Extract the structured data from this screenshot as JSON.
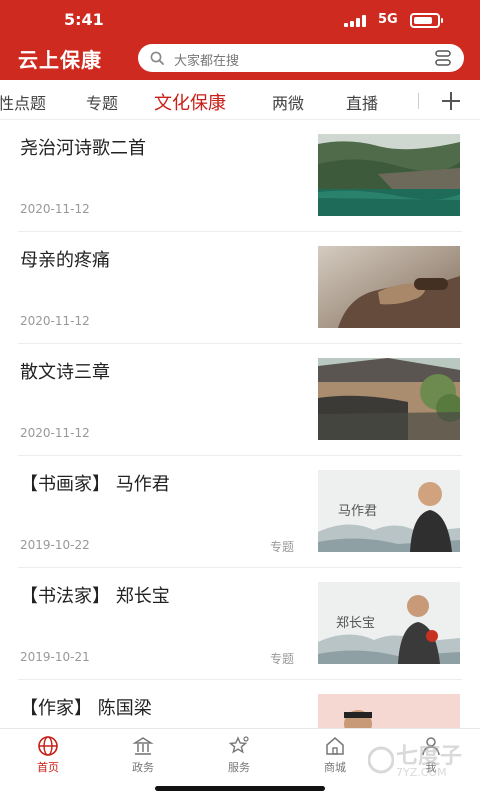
{
  "status_bar": {
    "time": "5:41",
    "network": "5G"
  },
  "header": {
    "app_title": "云上保康",
    "search_placeholder": "大家都在搜"
  },
  "tabs": [
    "性点题",
    "专题",
    "文化保康",
    "两微",
    "直播"
  ],
  "active_tab": "文化保康",
  "articles": [
    {
      "title": "尧治河诗歌二首",
      "date": "2020-11-12",
      "tag": ""
    },
    {
      "title": "母亲的疼痛",
      "date": "2020-11-12",
      "tag": ""
    },
    {
      "title": "散文诗三章",
      "date": "2020-11-12",
      "tag": ""
    },
    {
      "title": "【书画家】 马作君",
      "date": "2019-10-22",
      "tag": "专题",
      "image_caption": "马作君"
    },
    {
      "title": "【书法家】 郑长宝",
      "date": "2019-10-21",
      "tag": "专题",
      "image_caption": "郑长宝"
    },
    {
      "title": "【作家】 陈国梁",
      "date": "",
      "tag": ""
    }
  ],
  "bottom_tabs": [
    {
      "label": "首页",
      "icon": "globe-icon"
    },
    {
      "label": "政务",
      "icon": "building-icon"
    },
    {
      "label": "服务",
      "icon": "star-service-icon"
    },
    {
      "label": "商城",
      "icon": "house-icon"
    },
    {
      "label": "我",
      "icon": "user-icon"
    }
  ],
  "watermark": {
    "text": "七度子",
    "url": "7YZ.COM"
  },
  "colors": {
    "brand_red": "#cf2a1f",
    "active_red": "#c81f16",
    "muted": "#999999"
  }
}
